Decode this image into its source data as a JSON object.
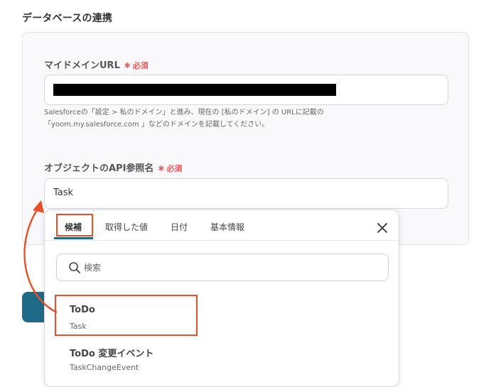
{
  "section": {
    "title": "データベースの連携"
  },
  "fields": {
    "domain_url": {
      "label": "マイドメインURL",
      "required_mark": "∗",
      "required_text": "必須",
      "help_line1": "Salesforceの「設定 > 私のドメイン」と進み、現在の [私のドメイン] の URLに記載の",
      "help_line2": "「yoom.my.salesforce.com 」などのドメインを記載してください。"
    },
    "object_api_name": {
      "label": "オブジェクトのAPI参照名",
      "required_mark": "∗",
      "required_text": "必須",
      "value": "Task"
    }
  },
  "dropdown": {
    "tabs": [
      {
        "label": "候補",
        "active": true
      },
      {
        "label": "取得した値",
        "active": false
      },
      {
        "label": "日付",
        "active": false
      },
      {
        "label": "基本情報",
        "active": false
      }
    ],
    "search": {
      "placeholder": "検索"
    },
    "options": [
      {
        "title": "ToDo",
        "subtitle": "Task"
      },
      {
        "title": "ToDo 変更イベント",
        "subtitle": "TaskChangeEvent"
      }
    ]
  },
  "colors": {
    "accent": "#1f6b87",
    "required": "#e85a5a",
    "annotation": "#e8502a"
  },
  "icons": {
    "close": "close-icon",
    "search": "search-icon"
  }
}
